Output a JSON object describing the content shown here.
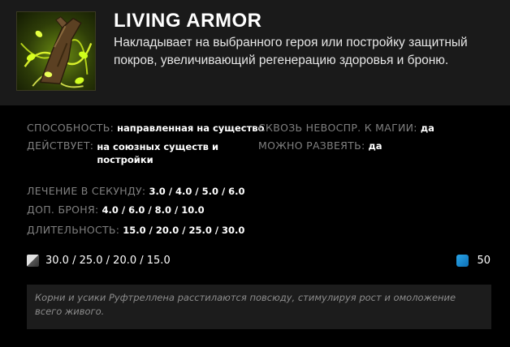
{
  "ability": {
    "name": "LIVING ARMOR",
    "description": "Накладывает на выбранного героя или постройку защитный покров, увеличивающий регенерацию здоровья и броню.",
    "icon": "treant-living-armor-icon"
  },
  "stats": {
    "ability_label": "СПОСОБНОСТЬ:",
    "ability_value": "направленная на существо",
    "pierces_label": "СКВОЗЬ НЕВОСПР. К МАГИИ:",
    "pierces_value": "да",
    "affects_label": "ДЕЙСТВУЕТ:",
    "affects_value": "на союзных существ и постройки",
    "dispellable_label": "МОЖНО РАЗВЕЯТЬ:",
    "dispellable_value": "да",
    "heal_label": "ЛЕЧЕНИЕ В СЕКУНДУ:",
    "heal_value": "3.0 / 4.0 / 5.0 / 6.0",
    "armor_label": "ДОП. БРОНЯ:",
    "armor_value": "4.0 / 6.0 / 8.0 / 10.0",
    "duration_label": "ДЛИТЕЛЬНОСТЬ:",
    "duration_value": "15.0 / 20.0 / 25.0 / 30.0"
  },
  "cooldown": {
    "icon": "cooldown-icon",
    "value": "30.0 / 25.0 / 20.0 / 15.0"
  },
  "mana": {
    "icon": "mana-icon",
    "value": "50"
  },
  "lore": "Корни и усики Руфтреллена расстилаются повсюду, стимулируя рост и омоложение всего живого.",
  "colors": {
    "header_bg": "#1a1a1a",
    "body_bg": "#000000",
    "label": "#7f7f7f",
    "mana": "#1e8fd6",
    "lore_bg": "#1c1c1c"
  }
}
